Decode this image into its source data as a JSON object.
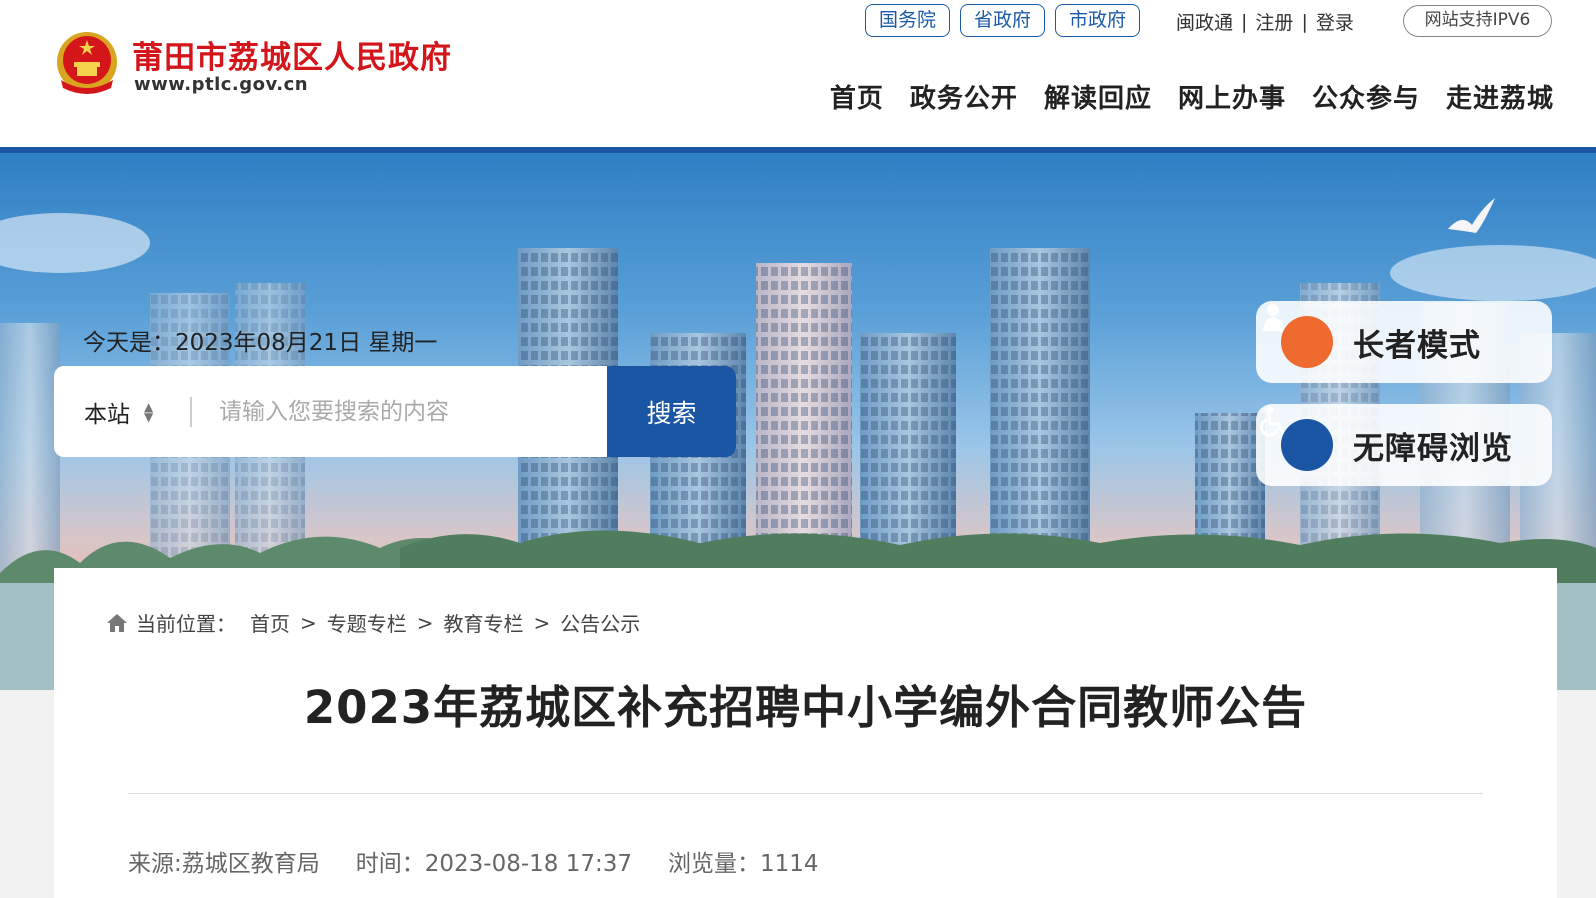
{
  "header": {
    "site_title": "莆田市荔城区人民政府",
    "site_url": "www.ptlc.gov.cn",
    "gov_links": [
      "国务院",
      "省政府",
      "市政府"
    ],
    "user_links": [
      "闽政通",
      "注册",
      "登录"
    ],
    "ipv6_label": "网站支持IPV6",
    "nav": [
      "首页",
      "政务公开",
      "解读回应",
      "网上办事",
      "公众参与",
      "走进荔城"
    ]
  },
  "banner": {
    "today_text": "今天是：2023年08月21日 星期一",
    "search": {
      "scope": "本站",
      "placeholder": "请输入您要搜索的内容",
      "button_label": "搜索"
    },
    "elder_mode_label": "长者模式",
    "accessible_label": "无障碍浏览"
  },
  "article": {
    "breadcrumb_label": "当前位置：",
    "breadcrumb": [
      "首页",
      "专题专栏",
      "教育专栏",
      "公告公示"
    ],
    "breadcrumb_sep": ">",
    "title": "2023年荔城区补充招聘中小学编外合同教师公告",
    "source": "来源:荔城区教育局",
    "time": "时间：2023-08-18 17:37",
    "views": "浏览量：1114"
  },
  "colors": {
    "brand_red": "#d4161a",
    "brand_blue": "#1b56a4",
    "elder_orange": "#ee6a2e",
    "accessible_blue": "#1b56a4"
  }
}
